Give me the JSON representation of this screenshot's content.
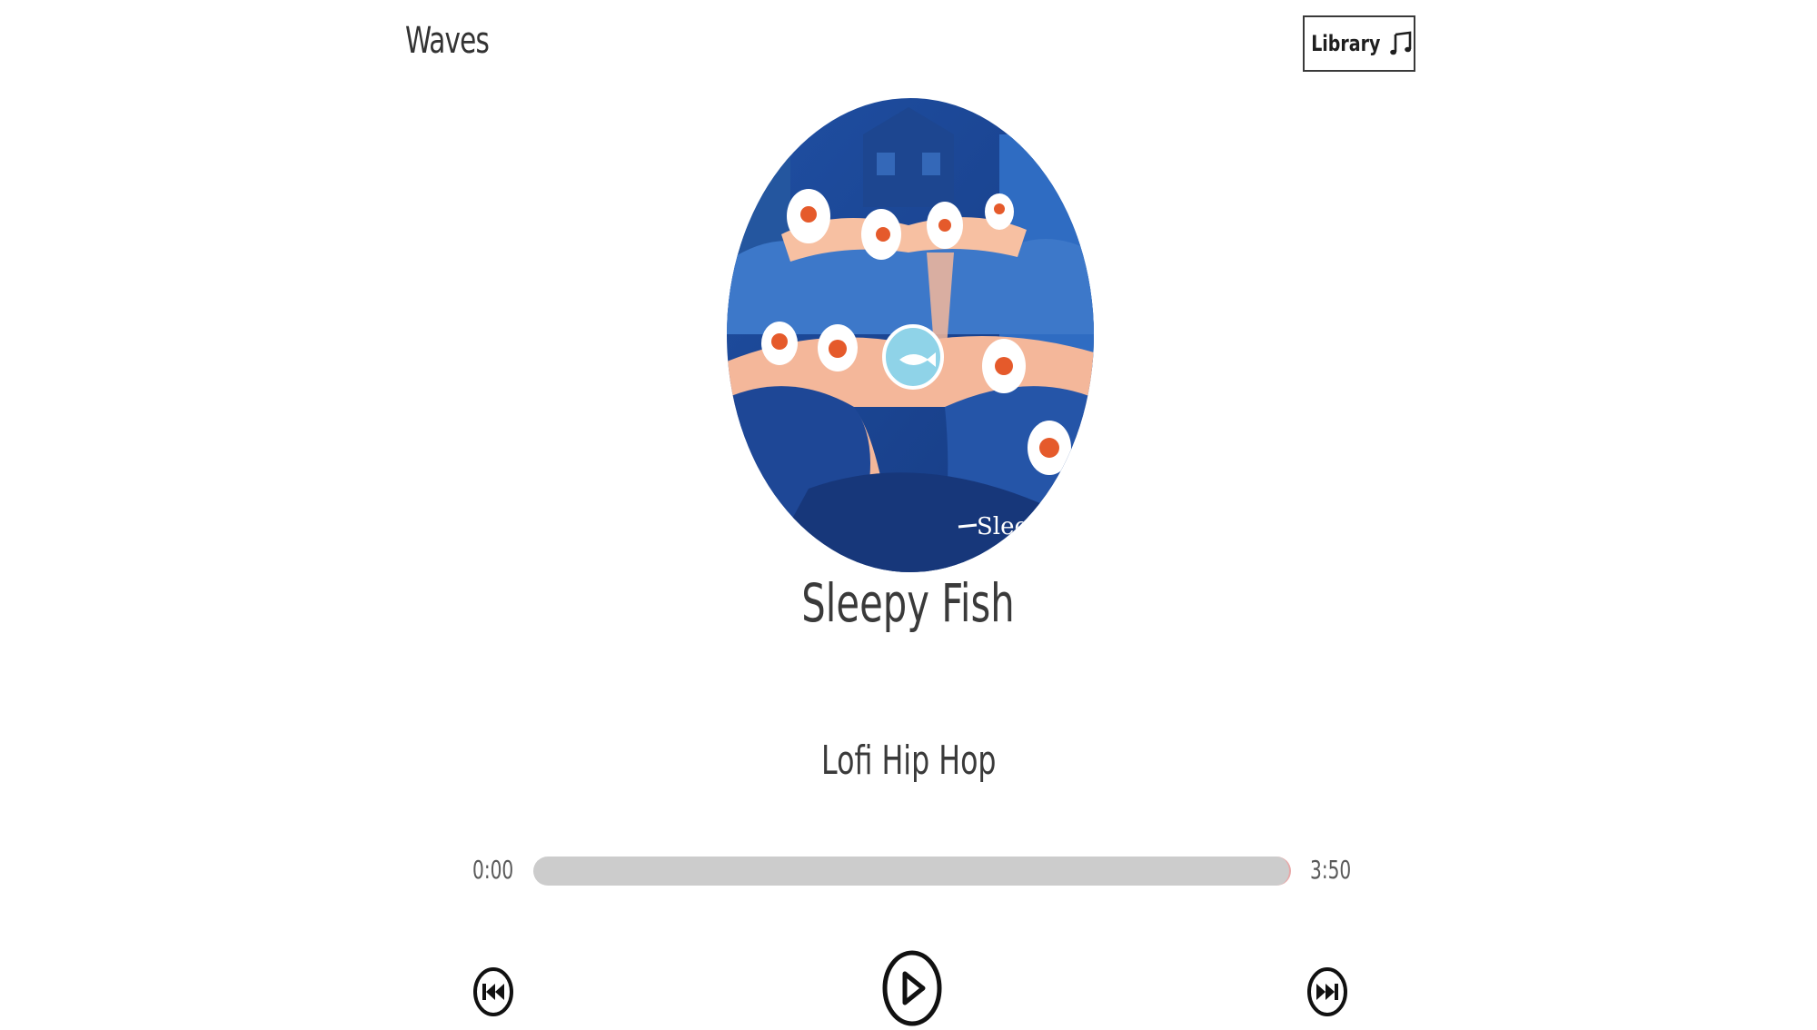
{
  "header": {
    "brand": "Waves",
    "library_label": "Library",
    "library_icon": "music-note-icon"
  },
  "song": {
    "title": "Sleepy Fish",
    "artist": "Lofi Hip Hop",
    "cover_icon": "album-cover-image"
  },
  "player": {
    "current_time": "0:00",
    "duration": "3:50",
    "progress": 0,
    "track_color": "#cccccc",
    "prev_icon": "skip-back-icon",
    "play_icon": "play-icon",
    "next_icon": "skip-forward-icon"
  },
  "colors": {
    "text": "#333333",
    "accent_pink": "#e8a7a7",
    "cover_blue": "#1c3f8a",
    "cover_peach": "#f4b79a"
  }
}
